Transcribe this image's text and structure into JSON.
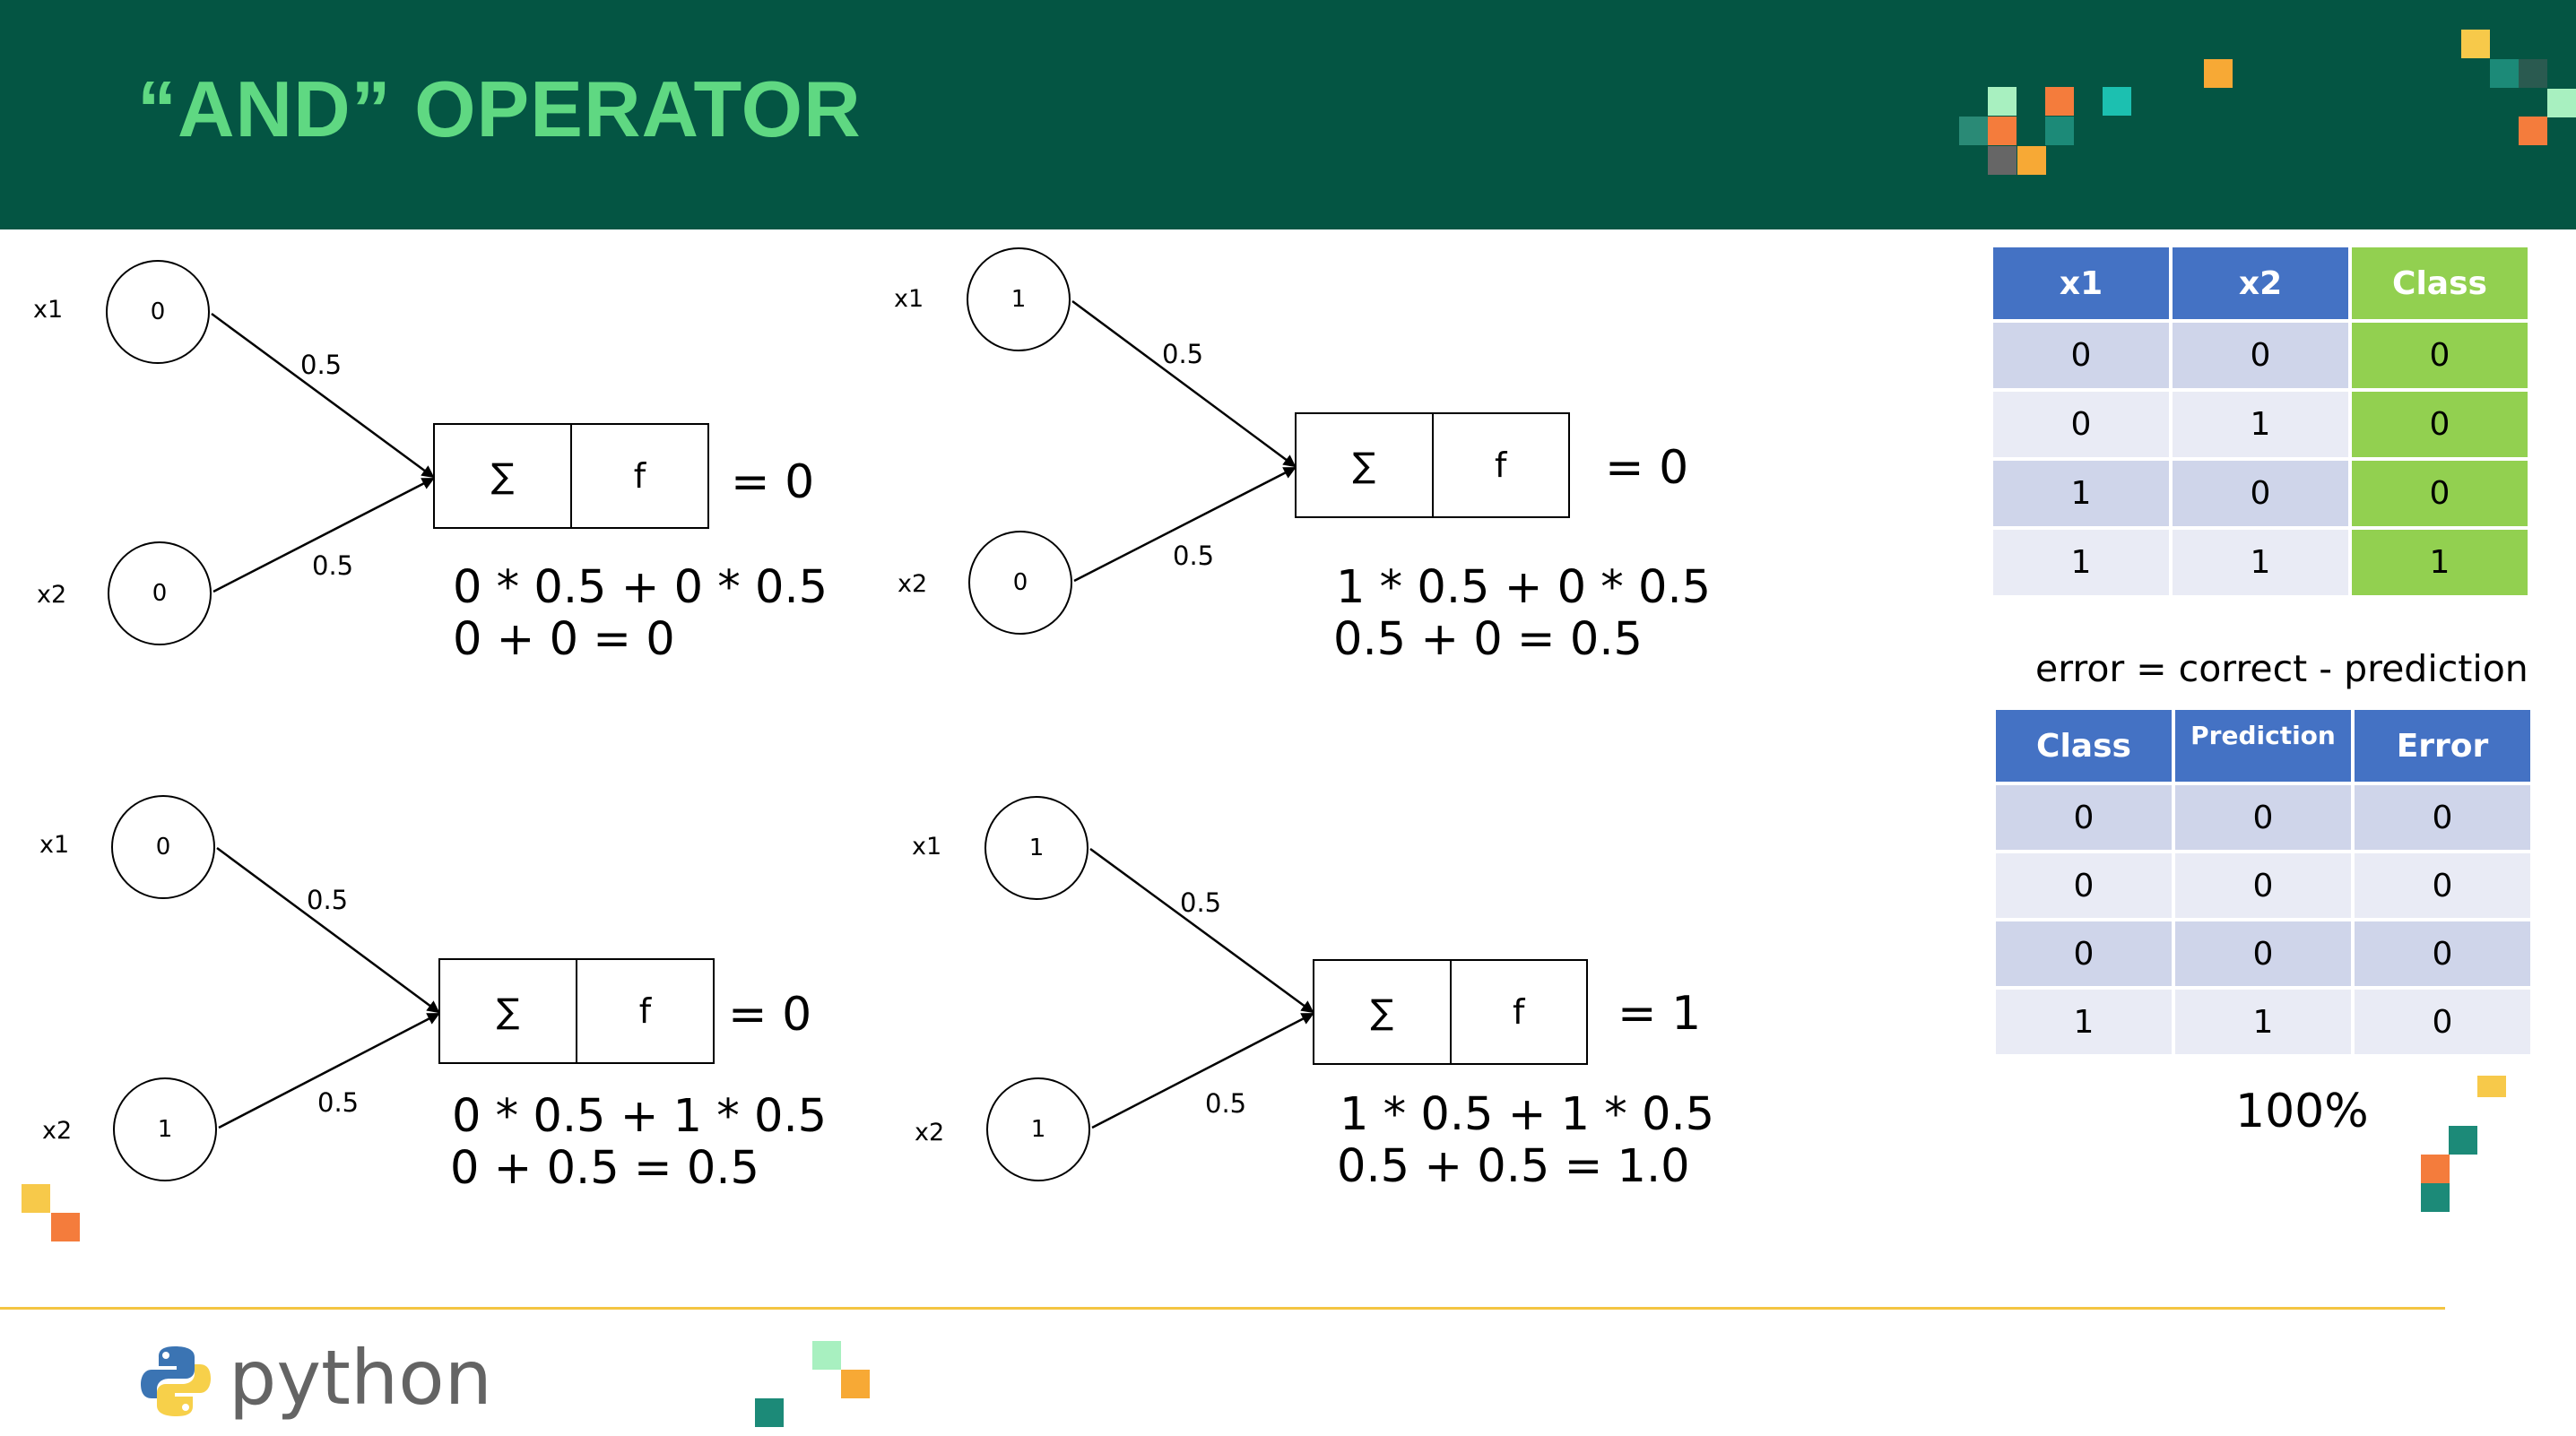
{
  "title": "“AND” OPERATOR",
  "colors": {
    "header_bg": "#045543",
    "title": "#5fd882",
    "table_header": "#4472c4",
    "class_green": "#92d050",
    "rule": "#f4c542"
  },
  "diagrams": [
    {
      "x1_label": "x1",
      "x2_label": "x2",
      "x1": "0",
      "x2": "0",
      "w1": "0.5",
      "w2": "0.5",
      "sigma": "∑",
      "f": "f",
      "result": "= 0",
      "calc1": "0 * 0.5 + 0 * 0.5",
      "calc2": "0 + 0 = 0"
    },
    {
      "x1_label": "x1",
      "x2_label": "x2",
      "x1": "1",
      "x2": "0",
      "w1": "0.5",
      "w2": "0.5",
      "sigma": "∑",
      "f": "f",
      "result": "= 0",
      "calc1": "1 * 0.5 + 0 * 0.5",
      "calc2": "0.5 + 0 = 0.5"
    },
    {
      "x1_label": "x1",
      "x2_label": "x2",
      "x1": "0",
      "x2": "1",
      "w1": "0.5",
      "w2": "0.5",
      "sigma": "∑",
      "f": "f",
      "result": "= 0",
      "calc1": "0 * 0.5 + 1 * 0.5",
      "calc2": "0 + 0.5 = 0.5"
    },
    {
      "x1_label": "x1",
      "x2_label": "x2",
      "x1": "1",
      "x2": "1",
      "w1": "0.5",
      "w2": "0.5",
      "sigma": "∑",
      "f": "f",
      "result": "= 1",
      "calc1": "1 * 0.5 + 1 * 0.5",
      "calc2": "0.5 + 0.5 = 1.0"
    }
  ],
  "truth_table": {
    "headers": [
      "x1",
      "x2",
      "Class"
    ],
    "rows": [
      [
        "0",
        "0",
        "0"
      ],
      [
        "0",
        "1",
        "0"
      ],
      [
        "1",
        "0",
        "0"
      ],
      [
        "1",
        "1",
        "1"
      ]
    ]
  },
  "error_formula": "error = correct - prediction",
  "error_table": {
    "headers": [
      "Class",
      "Prediction",
      "Error"
    ],
    "rows": [
      [
        "0",
        "0",
        "0"
      ],
      [
        "0",
        "0",
        "0"
      ],
      [
        "0",
        "0",
        "0"
      ],
      [
        "1",
        "1",
        "0"
      ]
    ]
  },
  "accuracy": "100%",
  "footer": {
    "logo_text": "python"
  }
}
